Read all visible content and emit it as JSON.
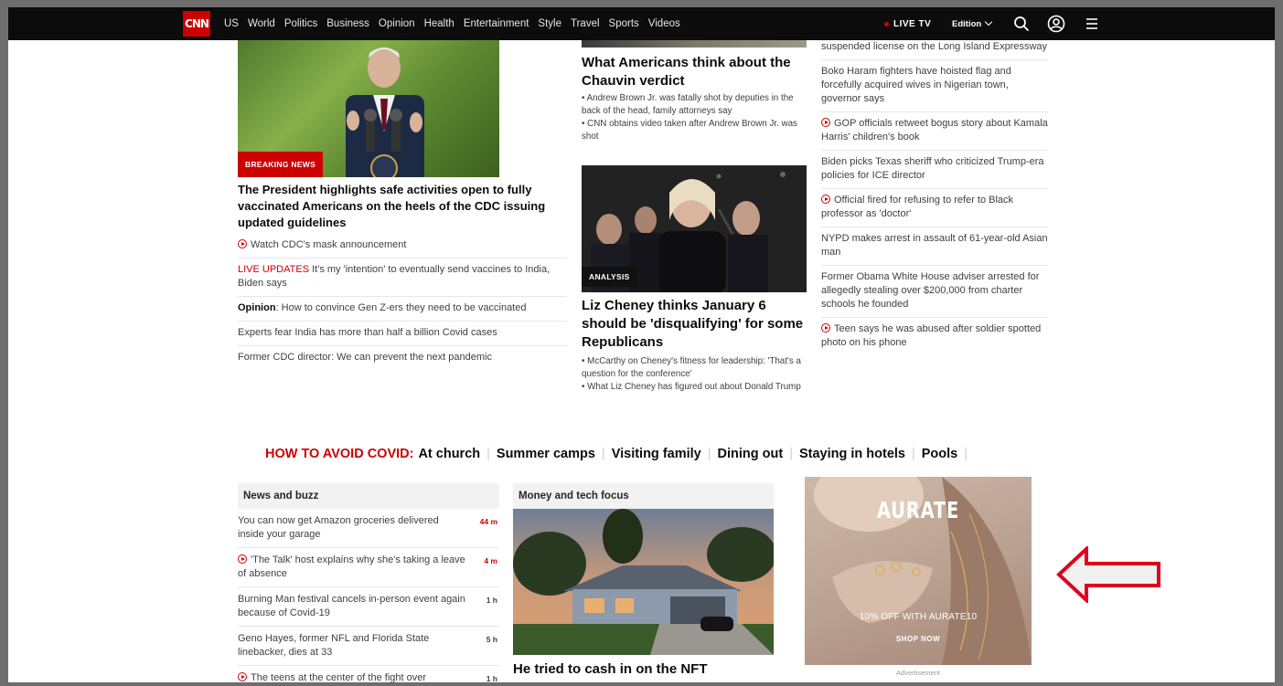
{
  "nav": {
    "logo": "CNN",
    "links": [
      "US",
      "World",
      "Politics",
      "Business",
      "Opinion",
      "Health",
      "Entertainment",
      "Style",
      "Travel",
      "Sports",
      "Videos"
    ],
    "live_tv": "LIVE TV",
    "edition": "Edition",
    "icons": [
      "search-icon",
      "account-icon",
      "menu-icon"
    ]
  },
  "left": {
    "badge": "BREAKING NEWS",
    "headline": "The President highlights safe activities open to fully vaccinated Americans on the heels of the CDC issuing updated guidelines",
    "items": {
      "i0": "Watch CDC's mask announcement",
      "i1_tag": "LIVE UPDATES",
      "i1_text": " It's my 'intention' to eventually send vaccines to India, Biden says",
      "i2_tag": "Opinion",
      "i2_text": ": How to convince Gen Z-ers they need to be vaccinated",
      "i3": "Experts fear India has more than half a billion Covid cases",
      "i4": "Former CDC director: We can prevent the next pandemic"
    }
  },
  "middle": {
    "chauvin": {
      "headline": "What Americans think about the Chauvin verdict",
      "bullets": [
        "• Andrew Brown Jr. was fatally shot by deputies in the back of the head, family attorneys say",
        "• CNN obtains video taken after Andrew Brown Jr. was shot"
      ]
    },
    "cheney": {
      "badge": "ANALYSIS",
      "headline": "Liz Cheney thinks January 6 should be 'disqualifying' for some Republicans",
      "bullets": [
        "• McCarthy on Cheney's fitness for leadership: 'That's a question for the conference'",
        "• What Liz Cheney has figured out about Donald Trump"
      ]
    }
  },
  "right": {
    "items": [
      {
        "text": "suspended license on the Long Island Expressway",
        "video": false
      },
      {
        "text": "Boko Haram fighters have hoisted flag and forcefully acquired wives in Nigerian town, governor says",
        "video": false
      },
      {
        "text": "GOP officials retweet bogus story about Kamala Harris' children's book",
        "video": true
      },
      {
        "text": "Biden picks Texas sheriff who criticized Trump-era policies for ICE director",
        "video": false
      },
      {
        "text": "Official fired for refusing to refer to Black professor as 'doctor'",
        "video": true
      },
      {
        "text": "NYPD makes arrest in assault of 61-year-old Asian man",
        "video": false
      },
      {
        "text": "Former Obama White House adviser arrested for allegedly stealing over $200,000 from charter schools he founded",
        "video": false
      },
      {
        "text": "Teen says he was abused after soldier spotted photo on his phone",
        "video": true
      }
    ]
  },
  "covid": {
    "label": "HOW TO AVOID COVID:",
    "links": [
      "At church",
      "Summer camps",
      "Visiting family",
      "Dining out",
      "Staying in hotels",
      "Pools"
    ]
  },
  "buzz": {
    "header": "News and buzz",
    "items": [
      {
        "text": "You can now get Amazon groceries delivered inside your garage",
        "time": "44 m"
      },
      {
        "text": "'The Talk' host explains why she's taking a leave of absence",
        "time": "4 m"
      },
      {
        "text": "Burning Man festival cancels in-person event again because of Covid-19",
        "time": "1 h"
      },
      {
        "text": "Geno Hayes, former NFL and Florida State linebacker, dies at 33",
        "time": "5 h"
      },
      {
        "text": "The teens at the center of the fight over",
        "time": "1 h"
      }
    ]
  },
  "money": {
    "header": "Money and tech focus",
    "headline": "He tried to cash in on the NFT"
  },
  "ad": {
    "brand": "AURATE",
    "offer": "10% OFF WITH AURATE10",
    "cta": "SHOP NOW",
    "label": "Advertisement"
  },
  "colors": {
    "brand_red": "#cc0000",
    "nav_bg": "#0c0c0c",
    "annotation_arrow": "#e0001b"
  }
}
